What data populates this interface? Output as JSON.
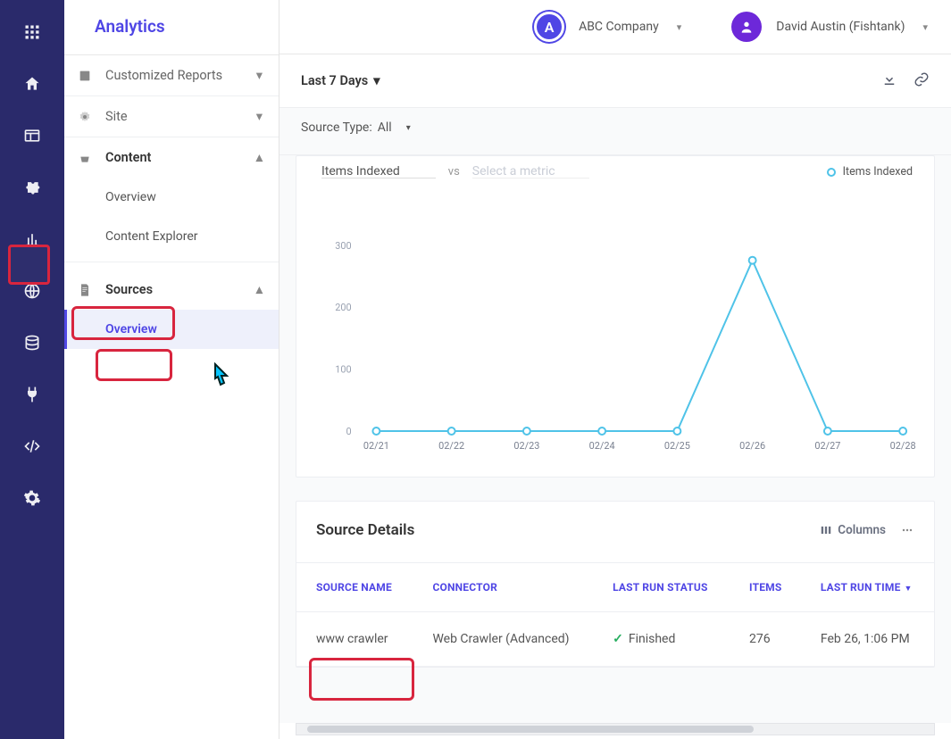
{
  "brand": {
    "title": "Analytics"
  },
  "topbar": {
    "company_initial": "A",
    "company_name": "ABC Company",
    "user_name": "David Austin (Fishtank)"
  },
  "filters": {
    "date_range": "Last 7 Days",
    "source_type_label": "Source Type:",
    "source_type_value": "All"
  },
  "sidebar": {
    "customized_reports": "Customized Reports",
    "site": "Site",
    "content": "Content",
    "content_items": [
      "Overview",
      "Content Explorer"
    ],
    "sources": "Sources",
    "sources_items": [
      "Overview"
    ]
  },
  "chart_data": {
    "type": "line",
    "title": "",
    "metric_selected": "Items Indexed",
    "metric_ghost": "Select a metric",
    "legend": "Items Indexed",
    "x": [
      "02/21",
      "02/22",
      "02/23",
      "02/24",
      "02/25",
      "02/26",
      "02/27",
      "02/28"
    ],
    "series": [
      {
        "name": "Items Indexed",
        "values": [
          0,
          0,
          0,
          0,
          0,
          276,
          0,
          0
        ]
      }
    ],
    "ylim": [
      0,
      300
    ],
    "yticks": [
      0,
      100,
      200,
      300
    ],
    "xlabel": "",
    "ylabel": ""
  },
  "details": {
    "heading": "Source Details",
    "columns_btn": "Columns",
    "headers": [
      "SOURCE NAME",
      "CONNECTOR",
      "LAST RUN STATUS",
      "ITEMS",
      "LAST RUN TIME"
    ],
    "rows": [
      {
        "source_name": "www crawler",
        "connector": "Web Crawler (Advanced)",
        "status": "Finished",
        "items": "276",
        "last_run": "Feb 26, 1:06 PM"
      }
    ]
  }
}
